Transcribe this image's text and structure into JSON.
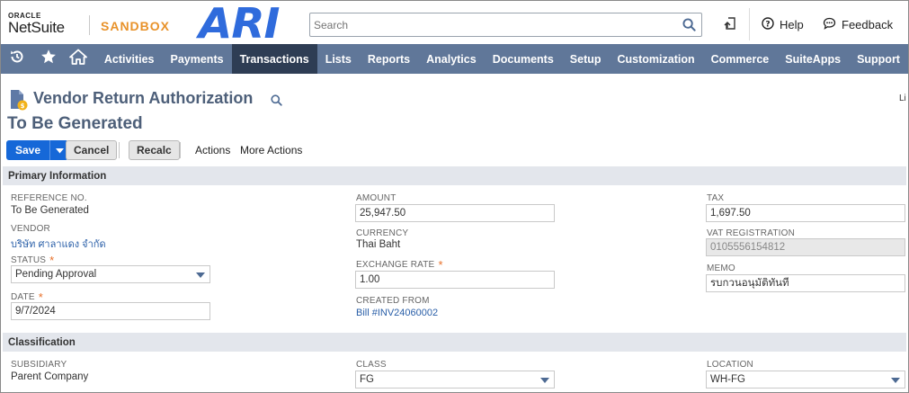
{
  "header": {
    "oracle": "ORACLE",
    "netsuite": "NetSuite",
    "sandbox": "SANDBOX",
    "brand": "ARI",
    "search_placeholder": "Search",
    "help": "Help",
    "feedback": "Feedback"
  },
  "nav": {
    "items": [
      "Activities",
      "Payments",
      "Transactions",
      "Lists",
      "Reports",
      "Analytics",
      "Documents",
      "Setup",
      "Customization",
      "Commerce",
      "SuiteApps",
      "Support"
    ],
    "active": "Transactions"
  },
  "page": {
    "title": "Vendor Return Authorization",
    "subtitle": "To Be Generated",
    "edge_text": "Li"
  },
  "toolbar": {
    "save": "Save",
    "cancel": "Cancel",
    "recalc": "Recalc",
    "actions": "Actions",
    "more_actions": "More Actions"
  },
  "primary": {
    "section_title": "Primary Information",
    "reference_label": "REFERENCE NO.",
    "reference_value": "To Be Generated",
    "vendor_label": "VENDOR",
    "vendor_value": "บริษัท ศาลาแดง จำกัด",
    "status_label": "STATUS",
    "status_value": "Pending Approval",
    "date_label": "DATE",
    "date_value": "9/7/2024",
    "amount_label": "AMOUNT",
    "amount_value": "25,947.50",
    "currency_label": "CURRENCY",
    "currency_value": "Thai Baht",
    "exchange_label": "EXCHANGE RATE",
    "exchange_value": "1.00",
    "created_from_label": "CREATED FROM",
    "created_from_value": "Bill #INV24060002",
    "tax_label": "TAX",
    "tax_value": "1,697.50",
    "vat_label": "VAT REGISTRATION",
    "vat_value": "0105556154812",
    "memo_label": "MEMO",
    "memo_value": "รบกวนอนุมัติทันที"
  },
  "classification": {
    "section_title": "Classification",
    "subsidiary_label": "SUBSIDIARY",
    "subsidiary_value": "Parent Company",
    "class_label": "CLASS",
    "class_value": "FG",
    "location_label": "LOCATION",
    "location_value": "WH-FG"
  },
  "colors": {
    "nav_bg": "#607799",
    "nav_active": "#2e3d54",
    "save_blue": "#1668d8",
    "sandbox_orange": "#e8922a",
    "brand_blue": "#2f6bdc",
    "title_color": "#4d5f79"
  }
}
